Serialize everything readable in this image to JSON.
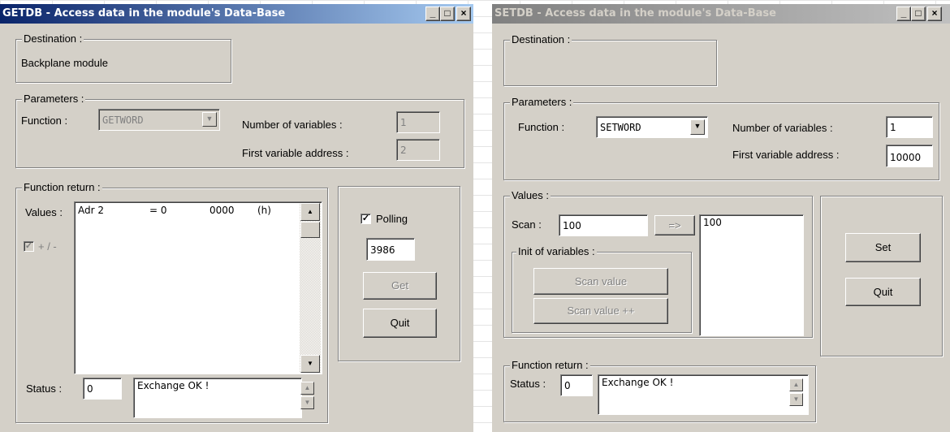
{
  "getdb": {
    "title": "GETDB - Access data in the module's Data-Base",
    "caption_buttons": {
      "minimize": "_",
      "maximize": "□",
      "close": "×"
    },
    "destination": {
      "group_label": "Destination :",
      "value": "Backplane module"
    },
    "parameters": {
      "group_label": "Parameters :",
      "function_label": "Function :",
      "function_value": "GETWORD",
      "num_vars_label": "Number of variables :",
      "num_vars_value": "1",
      "first_addr_label": "First variable address :",
      "first_addr_value": "2"
    },
    "function_return": {
      "group_label": "Function return :",
      "values_label": "Values :",
      "values_row": {
        "adr": "Adr 2",
        "eq": "= 0",
        "hex": "0000",
        "unit": "(h)"
      },
      "plusminus_label": "+ / -",
      "status_label": "Status :",
      "status_code": "0",
      "status_text": "Exchange OK !"
    },
    "polling_label": "Polling",
    "polling_counter": "3986",
    "get_button": "Get",
    "quit_button": "Quit"
  },
  "setdb": {
    "title": "SETDB - Access data in the module's Data-Base",
    "caption_buttons": {
      "minimize": "_",
      "maximize": "□",
      "close": "×"
    },
    "destination": {
      "group_label": "Destination :",
      "value": ""
    },
    "parameters": {
      "group_label": "Parameters :",
      "function_label": "Function :",
      "function_value": "SETWORD",
      "num_vars_label": "Number of variables :",
      "num_vars_value": "1",
      "first_addr_label": "First variable address :",
      "first_addr_value": "10000"
    },
    "values": {
      "group_label": "Values :",
      "scan_label": "Scan :",
      "scan_value": "100",
      "arrow_button": "=>",
      "list_item": "100",
      "init_group_label": "Init of variables :",
      "scan_value_button": "Scan value",
      "scan_value_pp_button": "Scan value ++"
    },
    "set_button": "Set",
    "quit_button": "Quit",
    "function_return": {
      "group_label": "Function return :",
      "status_label": "Status :",
      "status_code": "0",
      "status_text": "Exchange OK !"
    }
  }
}
